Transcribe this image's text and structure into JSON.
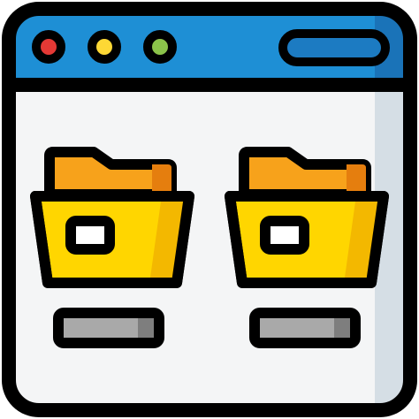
{
  "window": {
    "chrome_color": "#1E8FD5",
    "chrome_shadow_color": "#1A73B8",
    "body_color": "#F4F5F6",
    "body_shadow_color": "#D5DEE5",
    "outline_color": "#000000",
    "traffic_lights": [
      {
        "name": "close",
        "color": "#E53935"
      },
      {
        "name": "minimize",
        "color": "#FDD835"
      },
      {
        "name": "maximize",
        "color": "#8BC34A"
      }
    ],
    "address_bar_color": "#1C7BC2"
  },
  "folders": [
    {
      "name": "left-folder",
      "icon": "folder-icon",
      "back_color": "#F7A21B",
      "back_shadow_color": "#E57E0E",
      "front_color": "#FFD600",
      "front_shadow_color": "#F3B800",
      "tag_color": "#FFFFFF",
      "label_color": "#A9A9A9",
      "label_shadow_color": "#7E7E7E"
    },
    {
      "name": "right-folder",
      "icon": "folder-icon",
      "back_color": "#F7A21B",
      "back_shadow_color": "#E57E0E",
      "front_color": "#FFD600",
      "front_shadow_color": "#F3B800",
      "tag_color": "#FFFFFF",
      "label_color": "#A9A9A9",
      "label_shadow_color": "#7E7E7E"
    }
  ]
}
